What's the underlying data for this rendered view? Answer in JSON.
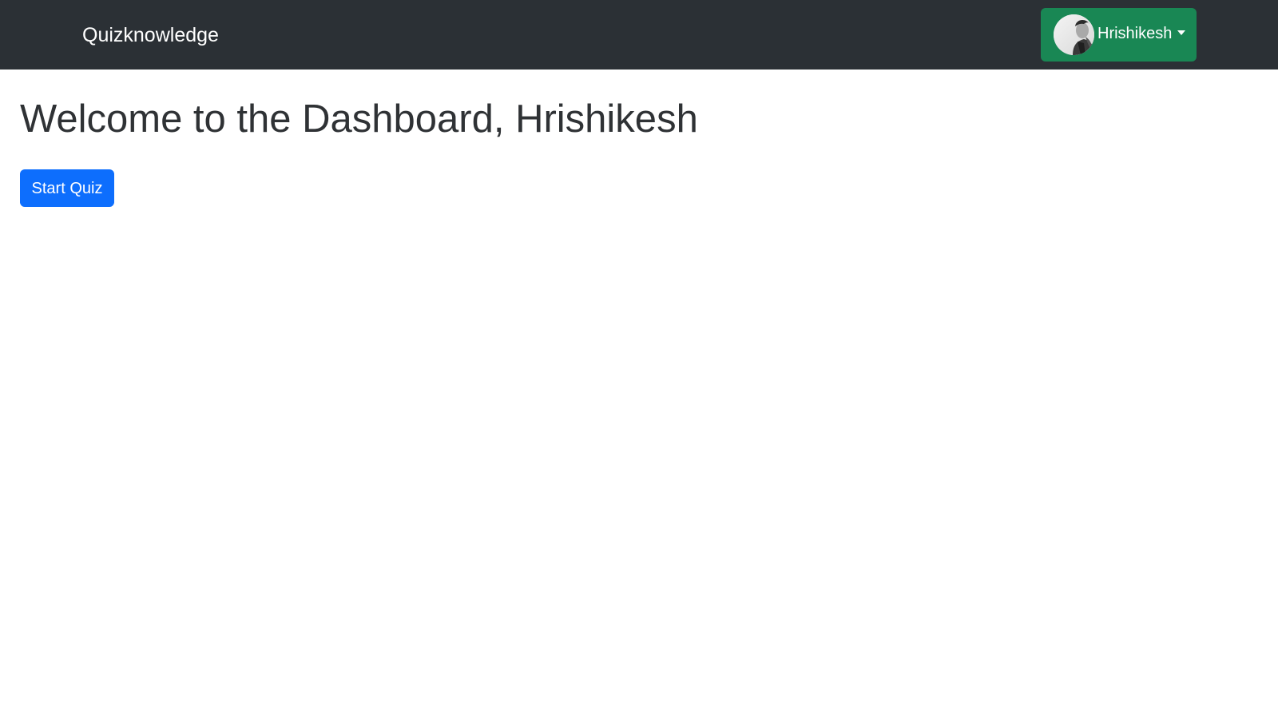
{
  "navbar": {
    "brand": "Quizknowledge",
    "user": {
      "name": "Hrishikesh",
      "avatar_icon": "user-avatar-photo",
      "dropdown_icon": "caret-down-icon",
      "button_color": "#198754"
    },
    "background_color": "#2b3035"
  },
  "main": {
    "title": "Welcome to the Dashboard, Hrishikesh",
    "start_button_label": "Start Quiz",
    "start_button_color": "#0d6efd"
  }
}
